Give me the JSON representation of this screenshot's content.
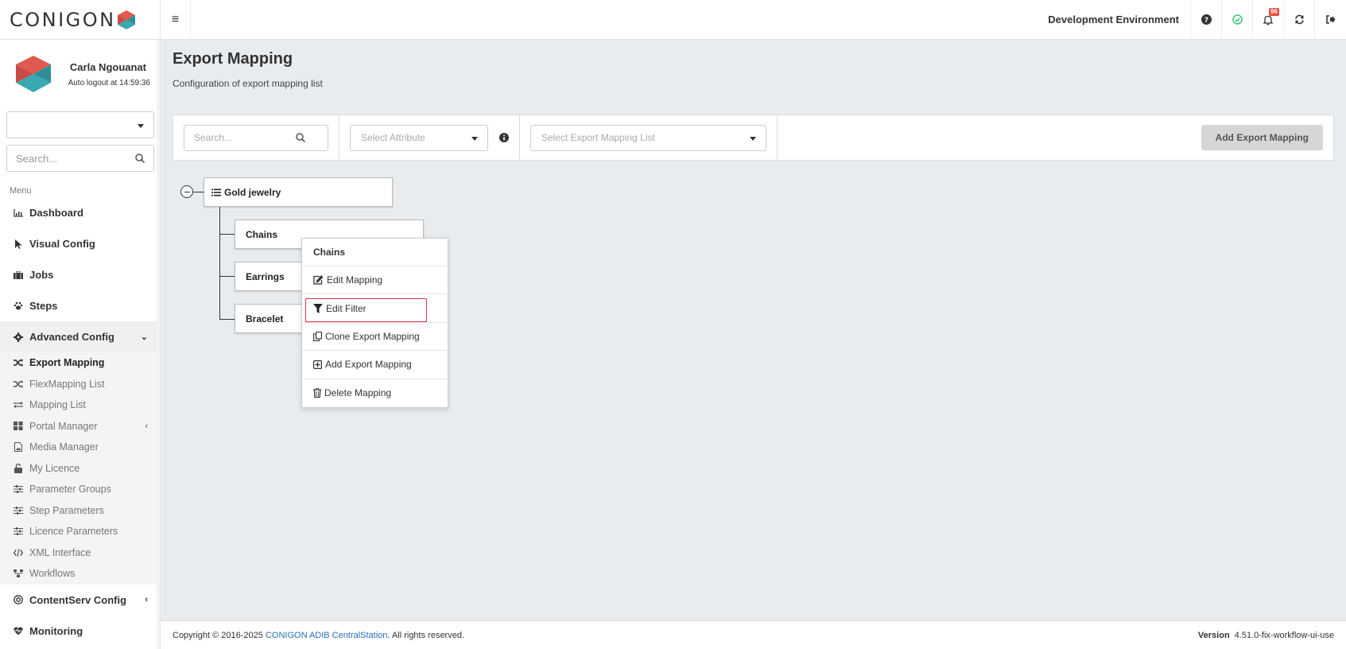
{
  "app": {
    "logo_text": "CONIGON",
    "environment": "Development Environment",
    "notification_count": "96"
  },
  "user": {
    "name": "Carla Ngouanat",
    "logout_text": "Auto logout at 14:59:36"
  },
  "sidebar": {
    "select_value": "",
    "search_placeholder": "Search...",
    "menu_header": "Menu",
    "items": [
      {
        "label": "Dashboard",
        "icon": "chart-icon"
      },
      {
        "label": "Visual Config",
        "icon": "pointer-icon"
      },
      {
        "label": "Jobs",
        "icon": "briefcase-icon"
      },
      {
        "label": "Steps",
        "icon": "paw-icon"
      },
      {
        "label": "Advanced Config",
        "icon": "gear-icon"
      }
    ],
    "advanced_items": [
      {
        "label": "Export Mapping",
        "icon": "shuffle-icon",
        "active": true
      },
      {
        "label": "FlexMapping List",
        "icon": "shuffle-icon"
      },
      {
        "label": "Mapping List",
        "icon": "exchange-icon"
      },
      {
        "label": "Portal Manager",
        "icon": "grid-icon"
      },
      {
        "label": "Media Manager",
        "icon": "file-image-icon"
      },
      {
        "label": "My Licence",
        "icon": "unlock-icon"
      },
      {
        "label": "Parameter Groups",
        "icon": "sliders-icon"
      },
      {
        "label": "Step Parameters",
        "icon": "sliders-icon"
      },
      {
        "label": "Licence Parameters",
        "icon": "sliders-icon"
      },
      {
        "label": "XML Interface",
        "icon": "code-icon"
      },
      {
        "label": "Workflows",
        "icon": "sitemap-icon"
      }
    ],
    "bottom_items": [
      {
        "label": "ContentServ Config",
        "icon": "target-icon"
      },
      {
        "label": "Monitoring",
        "icon": "heartbeat-icon"
      }
    ]
  },
  "page": {
    "title": "Export Mapping",
    "subtitle": "Configuration of export mapping list"
  },
  "toolbar": {
    "search_placeholder": "Search...",
    "attribute_placeholder": "Select Attribute",
    "list_placeholder": "Select Export Mapping List",
    "add_button": "Add Export Mapping"
  },
  "tree": {
    "root": "Gold jewelry",
    "children": [
      "Chains",
      "Earrings",
      "Bracelet"
    ]
  },
  "context_menu": {
    "title": "Chains",
    "items": [
      {
        "label": "Edit Mapping",
        "icon": "edit-icon"
      },
      {
        "label": "Edit Filter",
        "icon": "filter-icon",
        "highlighted": true
      },
      {
        "label": "Clone Export Mapping",
        "icon": "clone-icon"
      },
      {
        "label": "Add Export Mapping",
        "icon": "plus-square-icon"
      },
      {
        "label": "Delete Mapping",
        "icon": "trash-icon"
      }
    ]
  },
  "footer": {
    "copyright_prefix": "Copyright © 2016-2025",
    "brand": "CONIGON ADIB CentralStation",
    "copyright_suffix": ". All rights reserved.",
    "version_label": "Version",
    "version": "4.51.0-fix-workflow-ui-use"
  },
  "colors": {
    "accent_red": "#e05a4f",
    "accent_teal": "#3aa8b0",
    "highlight_border": "#d9364a",
    "link_blue": "#2a6ebb"
  }
}
